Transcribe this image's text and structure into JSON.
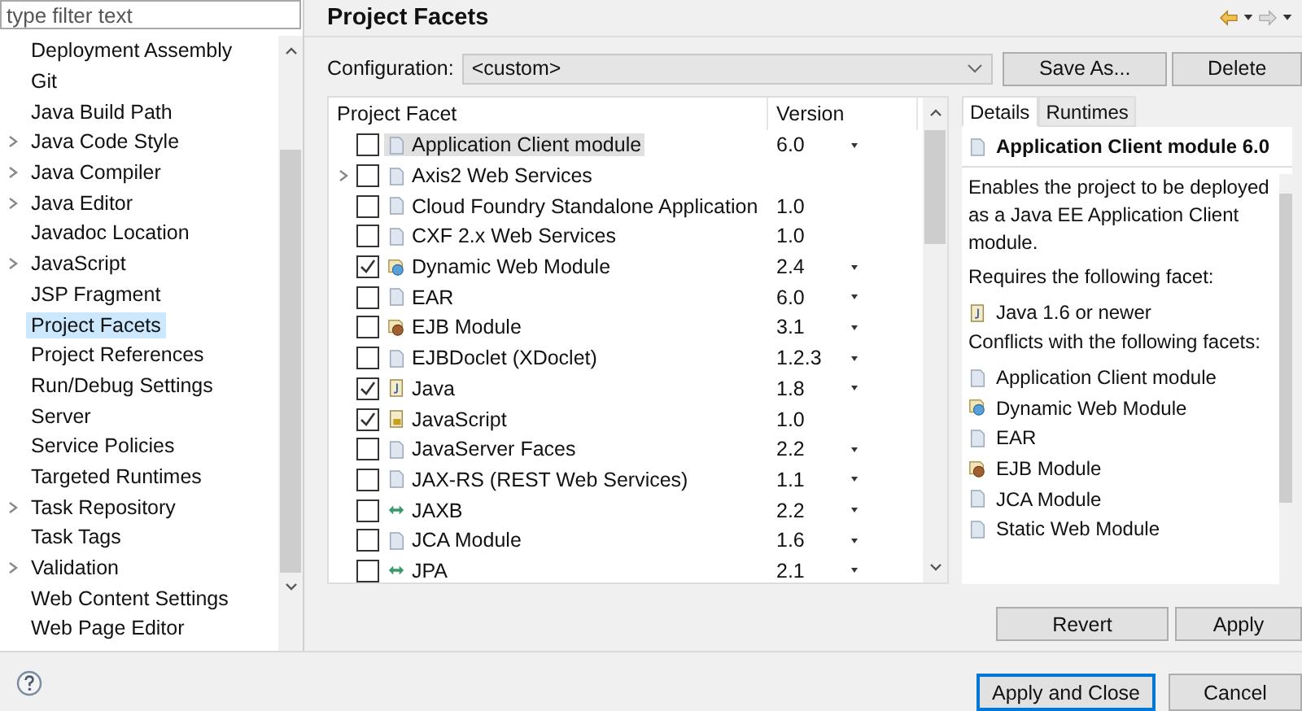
{
  "filter": {
    "placeholder": "type filter text"
  },
  "sidebar": {
    "items": [
      {
        "label": "Deployment Assembly",
        "expandable": false,
        "selected": false
      },
      {
        "label": "Git",
        "expandable": false,
        "selected": false
      },
      {
        "label": "Java Build Path",
        "expandable": false,
        "selected": false
      },
      {
        "label": "Java Code Style",
        "expandable": true,
        "selected": false
      },
      {
        "label": "Java Compiler",
        "expandable": true,
        "selected": false
      },
      {
        "label": "Java Editor",
        "expandable": true,
        "selected": false
      },
      {
        "label": "Javadoc Location",
        "expandable": false,
        "selected": false
      },
      {
        "label": "JavaScript",
        "expandable": true,
        "selected": false
      },
      {
        "label": "JSP Fragment",
        "expandable": false,
        "selected": false
      },
      {
        "label": "Project Facets",
        "expandable": false,
        "selected": true
      },
      {
        "label": "Project References",
        "expandable": false,
        "selected": false
      },
      {
        "label": "Run/Debug Settings",
        "expandable": false,
        "selected": false
      },
      {
        "label": "Server",
        "expandable": false,
        "selected": false
      },
      {
        "label": "Service Policies",
        "expandable": false,
        "selected": false
      },
      {
        "label": "Targeted Runtimes",
        "expandable": false,
        "selected": false
      },
      {
        "label": "Task Repository",
        "expandable": true,
        "selected": false
      },
      {
        "label": "Task Tags",
        "expandable": false,
        "selected": false
      },
      {
        "label": "Validation",
        "expandable": true,
        "selected": false
      },
      {
        "label": "Web Content Settings",
        "expandable": false,
        "selected": false
      },
      {
        "label": "Web Page Editor",
        "expandable": false,
        "selected": false
      }
    ]
  },
  "page_title": "Project Facets",
  "configuration": {
    "label": "Configuration:",
    "value": "<custom>"
  },
  "config_buttons": [
    "Save As...",
    "Delete"
  ],
  "table": {
    "columns": [
      "Project Facet",
      "Version"
    ],
    "rows": [
      {
        "name": "Application Client module",
        "kind": "page",
        "checked": false,
        "selected": true,
        "expandable": false,
        "version": "6.0",
        "dropdown": true
      },
      {
        "name": "Axis2 Web Services",
        "kind": "page",
        "checked": false,
        "selected": false,
        "expandable": true,
        "dropdown": false
      },
      {
        "name": "Cloud Foundry Standalone Application",
        "kind": "page",
        "checked": false,
        "selected": false,
        "expandable": false,
        "version": "1.0",
        "dropdown": false
      },
      {
        "name": "CXF 2.x Web Services",
        "kind": "page",
        "checked": false,
        "selected": false,
        "expandable": false,
        "version": "1.0",
        "dropdown": false
      },
      {
        "name": "Dynamic Web Module",
        "kind": "web",
        "checked": true,
        "selected": false,
        "expandable": false,
        "version": "2.4",
        "dropdown": true
      },
      {
        "name": "EAR",
        "kind": "page",
        "checked": false,
        "selected": false,
        "expandable": false,
        "version": "6.0",
        "dropdown": true
      },
      {
        "name": "EJB Module",
        "kind": "ejb",
        "checked": false,
        "selected": false,
        "expandable": false,
        "version": "3.1",
        "dropdown": true
      },
      {
        "name": "EJBDoclet (XDoclet)",
        "kind": "page",
        "checked": false,
        "selected": false,
        "expandable": false,
        "version": "1.2.3",
        "dropdown": true
      },
      {
        "name": "Java",
        "kind": "java",
        "checked": true,
        "selected": false,
        "expandable": false,
        "version": "1.8",
        "dropdown": true
      },
      {
        "name": "JavaScript",
        "kind": "js",
        "checked": true,
        "selected": false,
        "expandable": false,
        "version": "1.0",
        "dropdown": false
      },
      {
        "name": "JavaServer Faces",
        "kind": "page",
        "checked": false,
        "selected": false,
        "expandable": false,
        "version": "2.2",
        "dropdown": true
      },
      {
        "name": "JAX-RS (REST Web Services)",
        "kind": "page",
        "checked": false,
        "selected": false,
        "expandable": false,
        "version": "1.1",
        "dropdown": true
      },
      {
        "name": "JAXB",
        "kind": "link",
        "checked": false,
        "selected": false,
        "expandable": false,
        "version": "2.2",
        "dropdown": true
      },
      {
        "name": "JCA Module",
        "kind": "page",
        "checked": false,
        "selected": false,
        "expandable": false,
        "version": "1.6",
        "dropdown": true
      },
      {
        "name": "JPA",
        "kind": "link",
        "checked": false,
        "selected": false,
        "expandable": false,
        "version": "2.1",
        "dropdown": true
      }
    ]
  },
  "details": {
    "tabs": [
      {
        "label": "Details",
        "selected": true
      },
      {
        "label": "Runtimes",
        "selected": false
      }
    ],
    "title": "Application Client module 6.0",
    "description": "Enables the project to be deployed as a Java EE Application Client module.",
    "requires_heading": "Requires the following facet:",
    "requires": [
      {
        "label": "Java 1.6 or newer",
        "kind": "java"
      }
    ],
    "conflicts_heading": "Conflicts with the following facets:",
    "conflicts": [
      {
        "label": "Application Client module",
        "kind": "page"
      },
      {
        "label": "Dynamic Web Module",
        "kind": "web"
      },
      {
        "label": "EAR",
        "kind": "page"
      },
      {
        "label": "EJB Module",
        "kind": "ejb"
      },
      {
        "label": "JCA Module",
        "kind": "page"
      },
      {
        "label": "Static Web Module",
        "kind": "page"
      }
    ]
  },
  "page_buttons": [
    "Revert",
    "Apply"
  ],
  "footer_buttons": [
    {
      "label": "Apply and Close",
      "default": true
    },
    {
      "label": "Cancel",
      "default": false
    }
  ]
}
